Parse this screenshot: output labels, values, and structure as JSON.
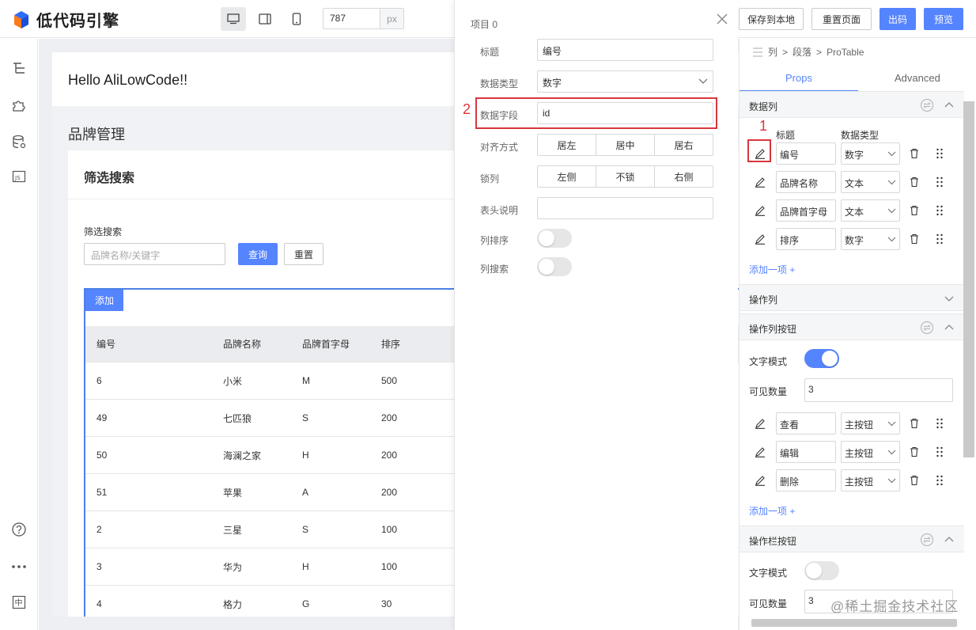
{
  "topbar": {
    "logo_text": "低代码引擎",
    "width_value": "787",
    "width_unit": "px",
    "buttons": {
      "save_local": "保存到本地",
      "reset_page": "重置页面",
      "export_code": "出码",
      "preview": "预览"
    }
  },
  "canvas": {
    "hello": "Hello AliLowCode!!",
    "brand_title": "品牌管理",
    "card_title": "筛选搜索",
    "filter_label": "筛选搜索",
    "filter_placeholder": "品牌名称/关键字",
    "query_label": "查询",
    "reset_label": "重置",
    "add_label": "添加",
    "columns": [
      "编号",
      "品牌名称",
      "品牌首字母",
      "排序"
    ],
    "rows": [
      [
        "6",
        "小米",
        "M",
        "500"
      ],
      [
        "49",
        "七匹狼",
        "S",
        "200"
      ],
      [
        "50",
        "海澜之家",
        "H",
        "200"
      ],
      [
        "51",
        "苹果",
        "A",
        "200"
      ],
      [
        "2",
        "三星",
        "S",
        "100"
      ],
      [
        "3",
        "华为",
        "H",
        "100"
      ],
      [
        "4",
        "格力",
        "G",
        "30"
      ]
    ]
  },
  "popup": {
    "title": "项目 0",
    "labels": {
      "title": "标题",
      "data_type": "数据类型",
      "data_field": "数据字段",
      "align": "对齐方式",
      "lock": "锁列",
      "header_desc": "表头说明",
      "sort": "列排序",
      "search": "列搜索"
    },
    "values": {
      "title": "编号",
      "data_type": "数字",
      "data_field": "id",
      "header_desc": ""
    },
    "align_options": [
      "居左",
      "居中",
      "居右"
    ],
    "lock_options": [
      "左侧",
      "不锁",
      "右侧"
    ]
  },
  "annotations": {
    "one": "1",
    "two": "2"
  },
  "right_panel": {
    "breadcrumb": [
      "列",
      "段落",
      "ProTable"
    ],
    "tabs": [
      "Props",
      "Advanced"
    ],
    "sections": {
      "data_columns": "数据列",
      "op_column": "操作列",
      "op_buttons": "操作列按钮",
      "toolbar_buttons": "操作栏按钮"
    },
    "col_headers": {
      "title": "标题",
      "type": "数据类型"
    },
    "data_columns": [
      {
        "title": "编号",
        "type": "数字"
      },
      {
        "title": "品牌名称",
        "type": "文本"
      },
      {
        "title": "品牌首字母",
        "type": "文本"
      },
      {
        "title": "排序",
        "type": "数字"
      }
    ],
    "add_item": "添加一项 +",
    "text_mode": "文字模式",
    "visible_count": "可见数量",
    "op_visible_value": "3",
    "op_buttons": [
      {
        "title": "查看",
        "type": "主按钮"
      },
      {
        "title": "编辑",
        "type": "主按钮"
      },
      {
        "title": "删除",
        "type": "主按钮"
      }
    ],
    "toolbar_visible_value": "3"
  },
  "watermark": "@稀土掘金技术社区",
  "colors": {
    "primary": "#5584ff",
    "annotation": "#d9363e"
  }
}
